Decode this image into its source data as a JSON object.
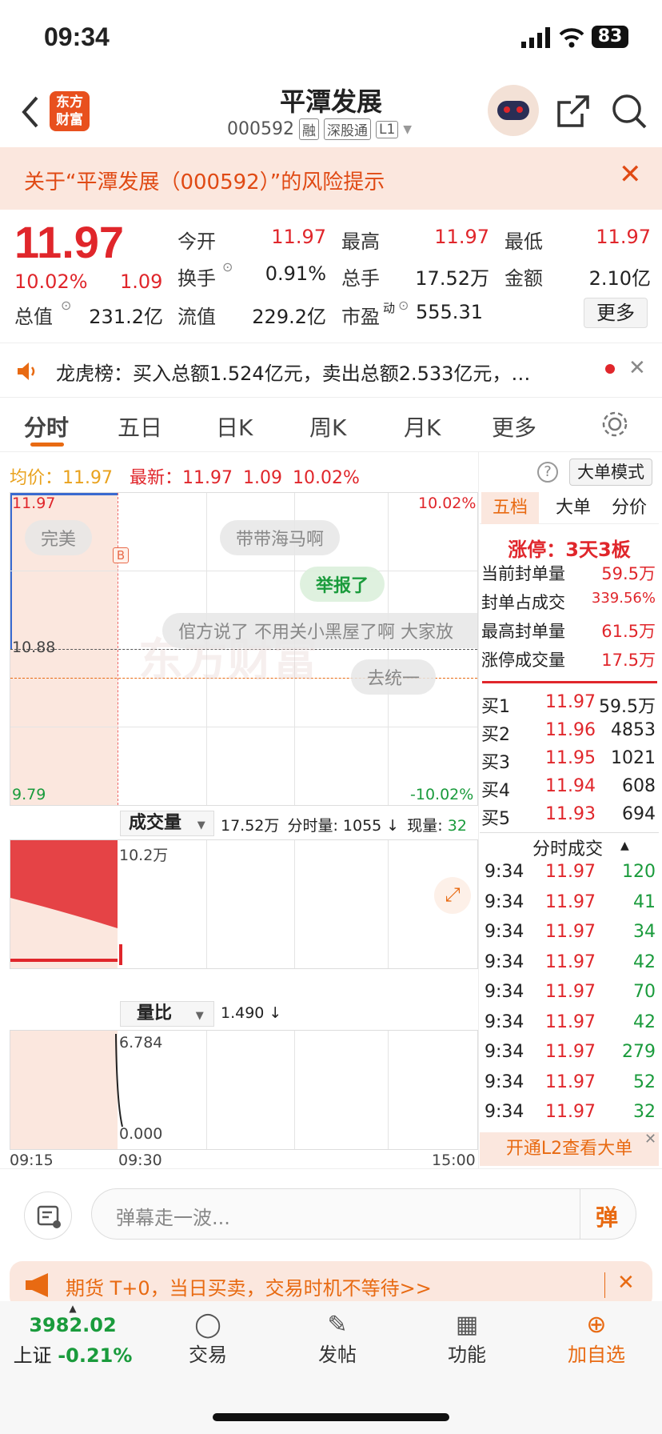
{
  "status_bar": {
    "time": "09:34",
    "battery": "83"
  },
  "header": {
    "back_icon": "chevron-left-icon",
    "logo_text": "东方财富",
    "title": "平潭发展",
    "code": "000592",
    "tags": [
      "融",
      "深股通",
      "L1"
    ],
    "robot_icon": "robot-avatar-icon",
    "share_icon": "share-icon",
    "search_icon": "search-icon"
  },
  "risk_banner": {
    "text": "关于“平潭发展（000592）”的风险提示"
  },
  "quote": {
    "price": "11.97",
    "change_pct": "10.02%",
    "change": "1.09",
    "open_label": "今开",
    "open": "11.97",
    "high_label": "最高",
    "high": "11.97",
    "low_label": "最低",
    "low": "11.97",
    "turnover_label": "换手",
    "turnover": "0.91%",
    "volume_label": "总手",
    "volume": "17.52万",
    "amount_label": "金额",
    "amount": "2.10亿",
    "mktcap_label": "总值",
    "mktcap": "231.2亿",
    "float_label": "流值",
    "float": "229.2亿",
    "pe_label": "市盈",
    "pe_sup": "动",
    "pe": "555.31",
    "more_label": "更多"
  },
  "notice": {
    "text": "龙虎榜：买入总额1.524亿元，卖出总额2.533亿元，…"
  },
  "tabs": [
    "分时",
    "五日",
    "日K",
    "周K",
    "月K",
    "更多"
  ],
  "info_line": {
    "avg_label": "均价：",
    "avg": "11.97",
    "latest_label": "最新：",
    "latest": "11.97",
    "latest_change": "1.09",
    "latest_pct": "10.02%",
    "big_order_mode": "大单模式"
  },
  "chart": {
    "y_top": "11.97",
    "y_mid": "10.88",
    "y_bottom": "9.79",
    "pct_top": "10.02%",
    "pct_bottom": "-10.02%",
    "marker": "B",
    "watermark": "东方财富",
    "danmaku": [
      "完美",
      "带带海马啊",
      "举报了",
      "倌方说了 不用关小黑屋了啊 大家放",
      "去统一"
    ]
  },
  "volume_panel": {
    "selector": "成交量",
    "total": "17.52万",
    "per_min_label": "分时量:",
    "per_min": "1055 ↓",
    "now_label": "现量:",
    "now": "32",
    "max": "10.2万"
  },
  "ratio_panel": {
    "selector": "量比",
    "value": "1.490 ↓",
    "top": "6.784",
    "bottom": "0.000"
  },
  "time_axis": [
    "09:15",
    "09:30",
    "15:00"
  ],
  "side_tabs": [
    "五档",
    "大单",
    "分价"
  ],
  "limit_up": {
    "title": "涨停：3天3板",
    "rows": [
      {
        "label": "当前封单量",
        "value": "59.5万"
      },
      {
        "label": "封单占成交",
        "value": "339.56%"
      },
      {
        "label": "最高封单量",
        "value": "61.5万"
      },
      {
        "label": "涨停成交量",
        "value": "17.5万"
      }
    ]
  },
  "bids": [
    {
      "label": "买1",
      "price": "11.97",
      "vol": "59.5万"
    },
    {
      "label": "买2",
      "price": "11.96",
      "vol": "4853"
    },
    {
      "label": "买3",
      "price": "11.95",
      "vol": "1021"
    },
    {
      "label": "买4",
      "price": "11.94",
      "vol": "608"
    },
    {
      "label": "买5",
      "price": "11.93",
      "vol": "694"
    }
  ],
  "ticks_title": "分时成交",
  "ticks": [
    {
      "t": "9:34",
      "p": "11.97",
      "v": "120"
    },
    {
      "t": "9:34",
      "p": "11.97",
      "v": "41"
    },
    {
      "t": "9:34",
      "p": "11.97",
      "v": "34"
    },
    {
      "t": "9:34",
      "p": "11.97",
      "v": "42"
    },
    {
      "t": "9:34",
      "p": "11.97",
      "v": "70"
    },
    {
      "t": "9:34",
      "p": "11.97",
      "v": "42"
    },
    {
      "t": "9:34",
      "p": "11.97",
      "v": "279"
    },
    {
      "t": "9:34",
      "p": "11.97",
      "v": "52"
    },
    {
      "t": "9:34",
      "p": "11.97",
      "v": "32"
    }
  ],
  "l2_banner": "开通L2查看大单",
  "danmu_input": {
    "placeholder": "弹幕走一波...",
    "send": "弹"
  },
  "promo": {
    "text": "期货 T+0，当日买卖，交易时机不等待>>"
  },
  "bottom_nav": {
    "index_value": "3982.02",
    "index_name": "上证",
    "index_change": "-0.21%",
    "items": [
      "交易",
      "发帖",
      "功能",
      "加自选"
    ]
  },
  "colors": {
    "up": "#e0262b",
    "down": "#1a9b3c",
    "accent": "#e86a12",
    "banner_bg": "#fbe7de"
  }
}
